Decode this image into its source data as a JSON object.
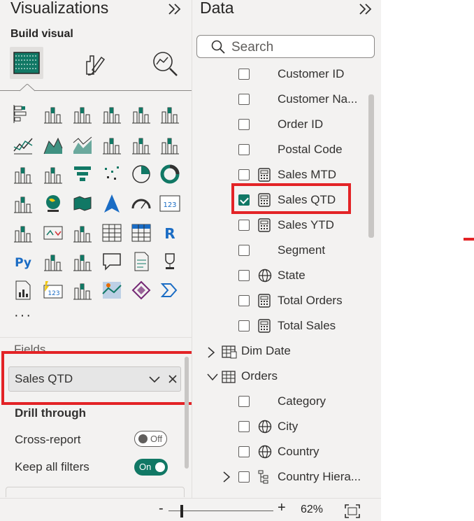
{
  "visualizations": {
    "title": "Visualizations",
    "collapse_icon": "double-chevron-right-icon",
    "build_visual_label": "Build visual",
    "top_tabs": [
      "build-visual-icon",
      "format-visual-icon",
      "analytics-icon"
    ],
    "more_label": "···",
    "fields_label": "Fields",
    "field_chip": {
      "value": "Sales QTD"
    },
    "drill_through_label": "Drill through",
    "cross_report": {
      "label": "Cross-report",
      "toggle_text": "Off"
    },
    "keep_all_filters": {
      "label": "Keep all filters",
      "toggle_text": "On"
    },
    "icons": [
      [
        "stacked-bar-chart-icon",
        "stacked-column-chart-icon",
        "clustered-bar-chart-icon",
        "clustered-column-chart-icon",
        "100-stacked-bar-chart-icon",
        "100-stacked-column-chart-icon"
      ],
      [
        "line-chart-icon",
        "area-chart-icon",
        "stacked-area-chart-icon",
        "100-stacked-area-chart-icon",
        "line-and-stacked-column-chart-icon",
        "line-and-clustered-column-chart-icon"
      ],
      [
        "ribbon-chart-icon",
        "waterfall-chart-icon",
        "funnel-icon",
        "scatter-chart-icon",
        "pie-chart-icon",
        "donut-chart-icon"
      ],
      [
        "treemap-icon",
        "map-icon",
        "filled-map-icon",
        "azure-map-icon",
        "gauge-icon",
        "card-icon"
      ],
      [
        "multi-row-card-icon",
        "kpi-icon",
        "slicer-icon",
        "table-icon",
        "matrix-icon",
        "r-visual-icon"
      ],
      [
        "python-visual-icon",
        "key-influencers-icon",
        "decomposition-tree-icon",
        "qa-icon",
        "smart-narrative-icon",
        "metrics-icon"
      ],
      [
        "paginated-report-icon",
        "new-card-icon",
        "new-slicer-icon",
        "arcgis-map-icon",
        "power-apps-icon",
        "power-automate-icon"
      ]
    ]
  },
  "data_pane": {
    "title": "Data",
    "collapse_icon": "double-chevron-right-icon",
    "search_placeholder": "Search",
    "items": [
      {
        "label": "Customer ID",
        "checked": false,
        "icon": ""
      },
      {
        "label": "Customer Na...",
        "checked": false,
        "icon": ""
      },
      {
        "label": "Order ID",
        "checked": false,
        "icon": ""
      },
      {
        "label": "Postal Code",
        "checked": false,
        "icon": ""
      },
      {
        "label": "Sales MTD",
        "checked": false,
        "icon": "calculator-icon"
      },
      {
        "label": "Sales QTD",
        "checked": true,
        "icon": "calculator-icon"
      },
      {
        "label": "Sales YTD",
        "checked": false,
        "icon": "calculator-icon"
      },
      {
        "label": "Segment",
        "checked": false,
        "icon": ""
      },
      {
        "label": "State",
        "checked": false,
        "icon": "globe-icon"
      },
      {
        "label": "Total Orders",
        "checked": false,
        "icon": "calculator-icon"
      },
      {
        "label": "Total Sales",
        "checked": false,
        "icon": "calculator-icon"
      }
    ],
    "tables": [
      {
        "label": "Dim Date",
        "expanded": false,
        "icon": "calendar-table-icon"
      },
      {
        "label": "Orders",
        "expanded": true,
        "icon": "table-icon"
      }
    ],
    "orders_items": [
      {
        "label": "Category",
        "checked": false,
        "icon": ""
      },
      {
        "label": "City",
        "checked": false,
        "icon": "globe-icon"
      },
      {
        "label": "Country",
        "checked": false,
        "icon": "globe-icon"
      },
      {
        "label": "Country Hiera...",
        "checked": false,
        "icon": "hierarchy-icon"
      }
    ]
  },
  "status_bar": {
    "zoom_minus": "-",
    "zoom_plus": "+",
    "zoom_level": "62%",
    "zoom_percent": 62,
    "fit_icon": "fit-to-page-icon"
  },
  "colors": {
    "accent": "#117865",
    "highlight": "#e32326",
    "pane_bg": "#f3f2f1"
  }
}
